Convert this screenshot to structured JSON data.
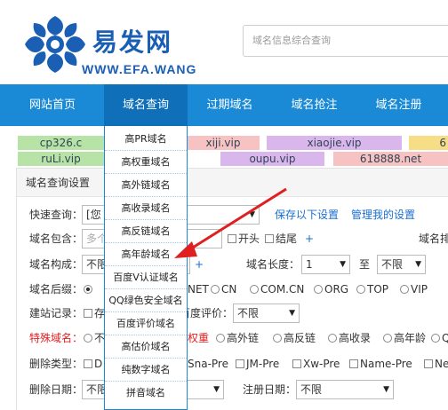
{
  "header": {
    "logo_cn": "易发网",
    "logo_en": "WWW.EFA.WANG",
    "search_placeholder": "域名信息综合查询"
  },
  "nav": {
    "items": [
      "网站首页",
      "域名查询",
      "过期域名",
      "域名抢注",
      "域名注册"
    ]
  },
  "tags": [
    "cp326.c",
    "xiji.vip",
    "xiaojie.vip",
    "6",
    "ruLi.vip",
    "oupu.vip",
    "618888.net"
  ],
  "tag_colors": [
    "#b7e3a7",
    "#f6c2c2",
    "#d9b6ec",
    "#f6dd86",
    "#b7e3a7",
    "#d9b6ec",
    "#f6c2c2"
  ],
  "dropdown": {
    "items": [
      "高PR域名",
      "高权重域名",
      "高外链域名",
      "高收录域名",
      "高反链域名",
      "高年龄域名",
      "百度V认证域名",
      "QQ绿色安全域名",
      "百度评价域名",
      "高估价域名",
      "纯数字域名",
      "拼音域名"
    ]
  },
  "panel": {
    "title": "域名查询设置",
    "quick": {
      "label": "快速查询：",
      "value": "[您",
      "save": "保存以下设置",
      "manage": "管理我的设置"
    },
    "contains": {
      "label": "域名包含：",
      "placeholder": "多个",
      "opt1": "开头",
      "opt2": "结尾",
      "plus": "+",
      "right": "域名排"
    },
    "structure": {
      "label": "域名构成：",
      "value": "不限",
      "plus": "+",
      "length_label": "域名长度：",
      "length_from": "1",
      "to": "至",
      "length_to": "不限"
    },
    "suffix": {
      "label": "域名后缀：",
      "opts": [
        "NET",
        "CN",
        "COM.CN",
        "ORG",
        "TOP",
        "VIP"
      ]
    },
    "record": {
      "label": "建站记录：",
      "opt": "存",
      "eval_label": "百度评价：",
      "eval_value": "不限"
    },
    "special": {
      "label": "特殊域名：",
      "opt0": "不",
      "opts": [
        "权重",
        "高外链",
        "高反链",
        "高收录",
        "高年龄",
        "Q"
      ]
    },
    "del_type": {
      "label": "删除类型：",
      "opts": [
        "D",
        "Sna-Pre",
        "JM-Pre",
        "Xw-Pre",
        "Name-Pre",
        "Ne"
      ]
    },
    "del_date": {
      "label": "删除日期：",
      "value": "不限",
      "reg_label": "注册日期：",
      "reg_value": "不限"
    }
  },
  "colors": {
    "nav": "#1b8ad6",
    "nav_active": "#0f6fb8",
    "brand": "#1a5fb4",
    "arrow": "#e02020"
  }
}
